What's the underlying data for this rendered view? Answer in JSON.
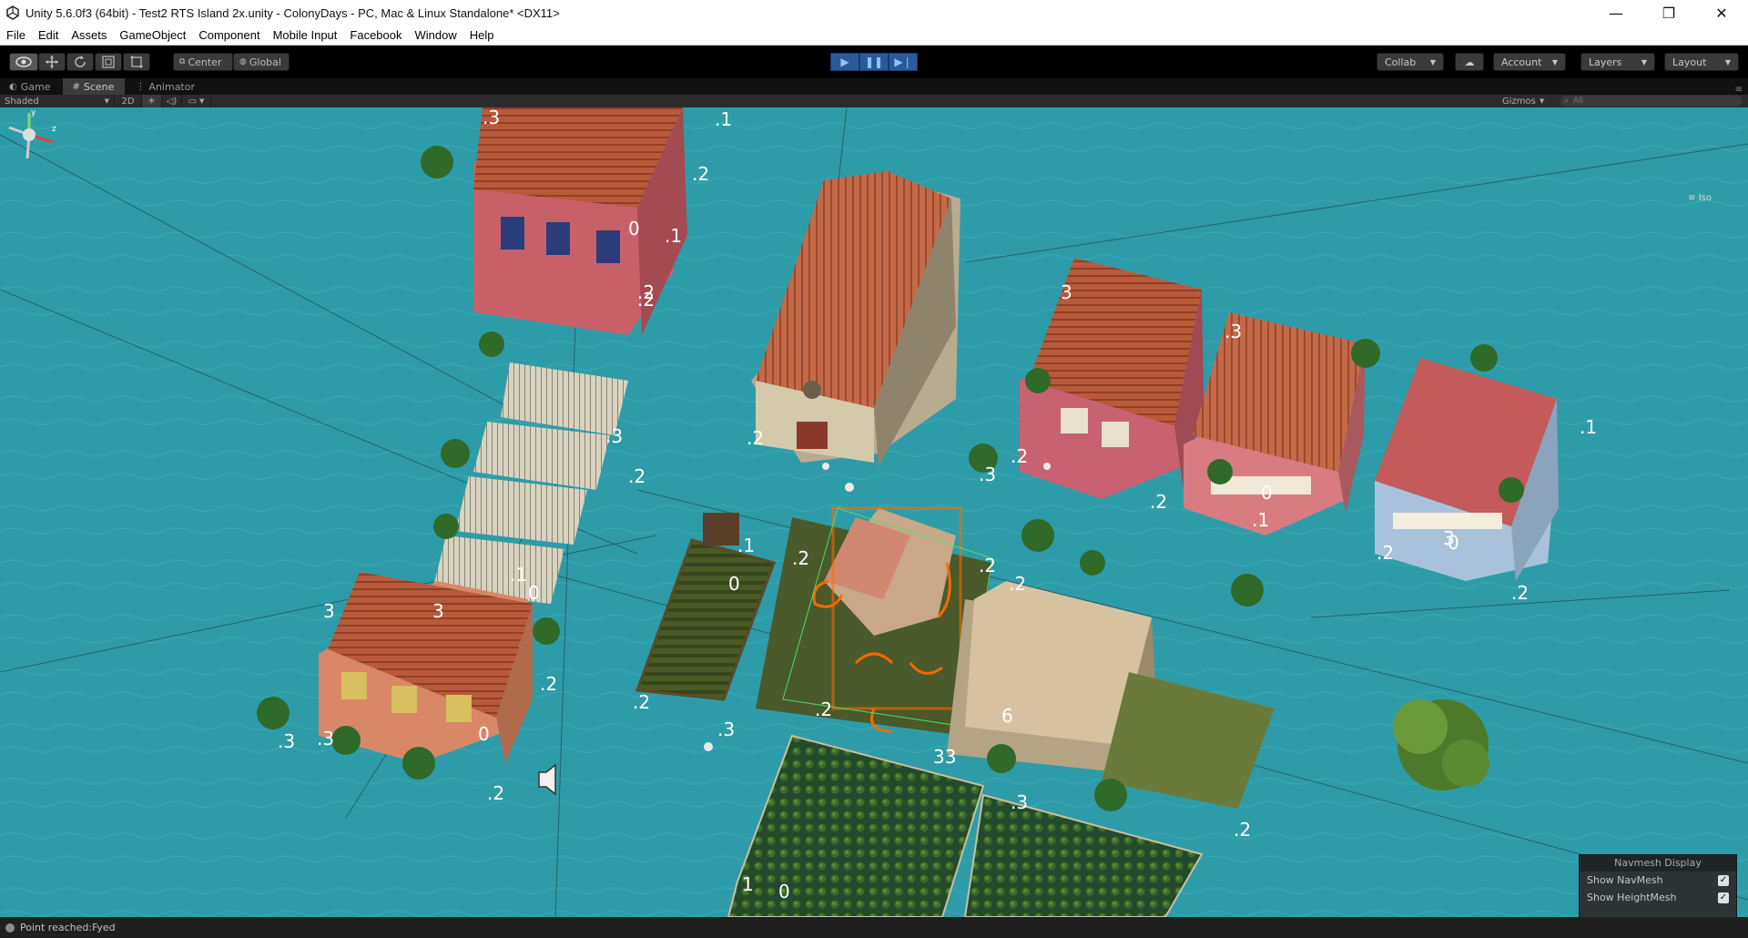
{
  "window": {
    "title": "Unity 5.6.0f3 (64bit) - Test2 RTS Island 2x.unity - ColonyDays - PC, Mac & Linux Standalone* <DX11>",
    "controls": [
      "—",
      "❐",
      "✕"
    ]
  },
  "menu": [
    "File",
    "Edit",
    "Assets",
    "GameObject",
    "Component",
    "Mobile Input",
    "Facebook",
    "Window",
    "Help"
  ],
  "toolbar": {
    "pivot": "Center",
    "space": "Global",
    "collab": "Collab",
    "account": "Account",
    "layers": "Layers",
    "layout": "Layout"
  },
  "tabs": [
    {
      "label": "Game",
      "icon": "gamepad-icon",
      "active": false
    },
    {
      "label": "Scene",
      "icon": "grid-icon",
      "active": true
    },
    {
      "label": "Animator",
      "icon": "animator-icon",
      "active": false
    }
  ],
  "scene_toolbar": {
    "shading": "Shaded",
    "mode_2d": "2D",
    "gizmos": "Gizmos",
    "search_placeholder": "All"
  },
  "scene": {
    "projection": "Iso",
    "water_color": "#2d9aa6",
    "selection_color": "#ff6a00",
    "labels": [
      ".1",
      ".2",
      ".3",
      "0",
      ".1",
      ".2",
      ".2",
      "3",
      ".3",
      ".2",
      ".2",
      "0",
      ".1",
      ".2",
      "3",
      "0",
      ".2",
      ".1",
      ".2",
      ".3",
      ".2",
      "0",
      ".1",
      ".2",
      ".3",
      "3",
      "0",
      ".2",
      ".3",
      ".2",
      ".2",
      ".3",
      "6",
      ".2",
      ".1",
      "0",
      ".2",
      ".3",
      "33",
      ".2",
      "1",
      "0",
      ".2",
      ".3",
      "3"
    ]
  },
  "navmesh_display": {
    "title": "Navmesh Display",
    "show_navmesh": "Show NavMesh",
    "show_heightmesh": "Show HeightMesh",
    "checked": "✓"
  },
  "status": {
    "message": "Point reached:Fyed"
  }
}
